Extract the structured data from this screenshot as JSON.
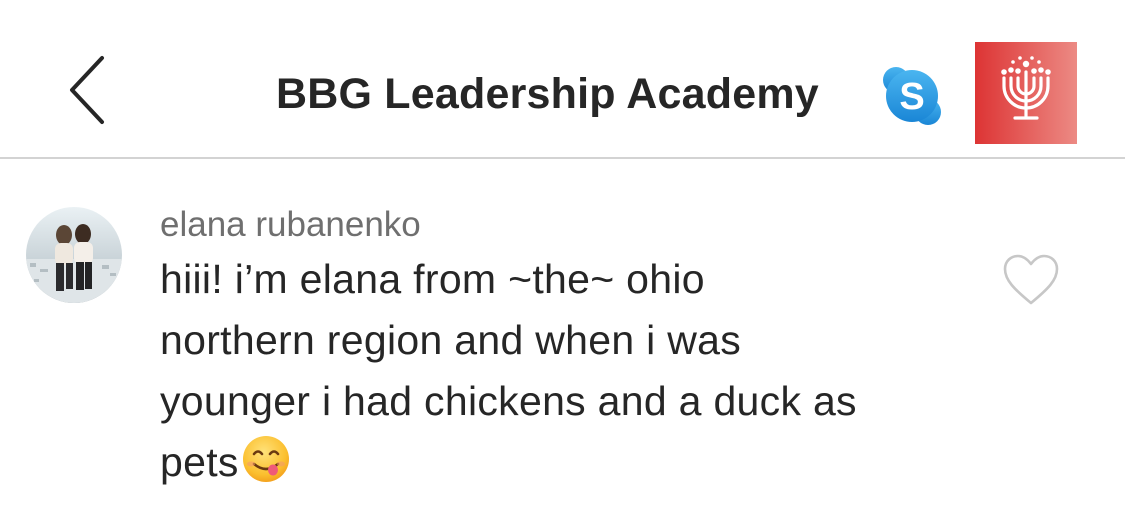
{
  "header": {
    "title": "BBG Leadership Academy",
    "back_icon": "chevron-left-icon",
    "skype_letter": "S",
    "skype_color": "#2a9bdf",
    "logo_color": "#e0413e",
    "logo_icon": "menorah-icon"
  },
  "comment": {
    "username": "elana rubanenko",
    "text_lines": [
      "hiii! i’m elana from ~the~ ohio",
      "northern region and when i was",
      "younger i had chickens and a duck as",
      "pets"
    ],
    "emoji_icon": "face-savoring-food-icon",
    "like_icon": "heart-outline-icon"
  },
  "colors": {
    "text": "#262626",
    "secondary_text": "#6f6f6f",
    "divider": "#d3d3d3"
  }
}
